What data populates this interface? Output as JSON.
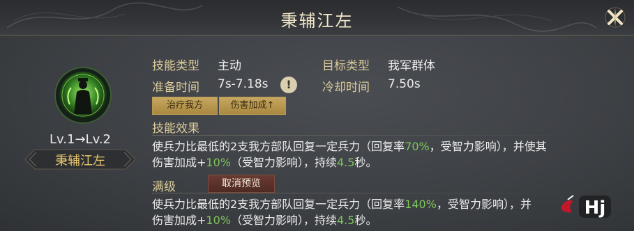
{
  "title": "秉辅江左",
  "skill": {
    "level_text": "Lv.1→Lv.2",
    "name": "秉辅江左",
    "icon": "strategist-figure-icon"
  },
  "info": {
    "skill_type_label": "技能类型",
    "skill_type_value": "主动",
    "target_type_label": "目标类型",
    "target_type_value": "我军群体",
    "prepare_label": "准备时间",
    "prepare_value": "7s-7.18s",
    "cooldown_label": "冷却时间",
    "cooldown_value": "7.50s",
    "info_icon": "!"
  },
  "tags": [
    "治疗我方",
    "伤害加成↑"
  ],
  "effect": {
    "heading": "技能效果",
    "line1": [
      "使兵力比最低的2支我方部队回复一定兵力（回复率",
      "70%",
      "，受智力影响），并使其"
    ],
    "line2": [
      "伤害加成+",
      "10%",
      "（受智力影响），持续",
      "4.5",
      "秒。"
    ]
  },
  "max_level": {
    "heading": "满级",
    "button_label": "取消预览",
    "line1": [
      "使兵力比最低的2支我方部队回复一定兵力（回复率",
      "140%",
      "，受智力影响），并"
    ],
    "line2": [
      "伤害加成+",
      "10%",
      "（受智力影响），持续",
      "4.5",
      "秒。"
    ]
  },
  "watermark_text": "Hj",
  "colors": {
    "accent_gold": "#dccb9a",
    "highlight_green": "#7fc55a",
    "skill_glow": "#5fd23a"
  }
}
